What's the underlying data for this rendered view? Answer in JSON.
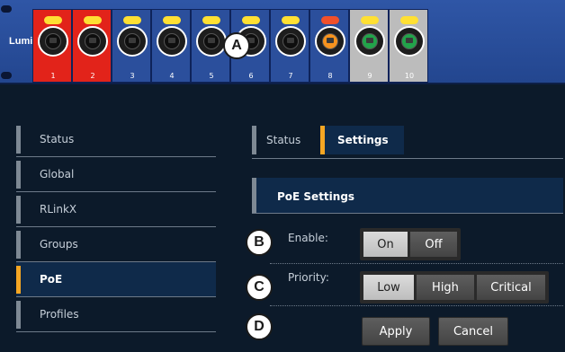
{
  "device": {
    "brand": "Luminex",
    "ports": [
      {
        "number": "1",
        "bg": "#e2231a",
        "led": "#ffe033",
        "jack": "#ffffff",
        "inner": "#0e0e0e"
      },
      {
        "number": "2",
        "bg": "#e2231a",
        "led": "#ffe033",
        "jack": "#ffffff",
        "inner": "#0e0e0e"
      },
      {
        "number": "3",
        "bg": "#2b4f9c",
        "led": "#ffe033",
        "jack": "#ffffff",
        "inner": "#0e0e0e"
      },
      {
        "number": "4",
        "bg": "#2b4f9c",
        "led": "#ffe033",
        "jack": "#ffffff",
        "inner": "#0e0e0e"
      },
      {
        "number": "5",
        "bg": "#2b4f9c",
        "led": "#ffe033",
        "jack": "#ffffff",
        "inner": "#0e0e0e"
      },
      {
        "number": "6",
        "bg": "#2b4f9c",
        "led": "#ffe033",
        "jack": "#ffffff",
        "inner": "#0e0e0e"
      },
      {
        "number": "7",
        "bg": "#2b4f9c",
        "led": "#ffe033",
        "jack": "#ffffff",
        "inner": "#0e0e0e"
      },
      {
        "number": "8",
        "bg": "#2b4f9c",
        "led": "#f0502a",
        "jack": "#ffffff",
        "inner": "#f7931e"
      },
      {
        "number": "9",
        "bg": "#bcbcbc",
        "led": "#ffe033",
        "jack": "#ffffff",
        "inner": "#22a34a"
      },
      {
        "number": "10",
        "bg": "#bcbcbc",
        "led": "#ffe033",
        "jack": "#ffffff",
        "inner": "#22a34a"
      }
    ]
  },
  "sidebar": {
    "items": [
      {
        "label": "Status",
        "active": false
      },
      {
        "label": "Global",
        "active": false
      },
      {
        "label": "RLinkX",
        "active": false
      },
      {
        "label": "Groups",
        "active": false
      },
      {
        "label": "PoE",
        "active": true
      },
      {
        "label": "Profiles",
        "active": false
      }
    ]
  },
  "tabs": {
    "status_label": "Status",
    "settings_label": "Settings",
    "active": "Settings"
  },
  "poe": {
    "title": "PoE Settings",
    "enable_label": "Enable:",
    "enable_options": [
      "On",
      "Off"
    ],
    "enable_selected": "On",
    "priority_label": "Priority:",
    "priority_options": [
      "Low",
      "High",
      "Critical"
    ],
    "priority_selected": "Low",
    "apply_label": "Apply",
    "cancel_label": "Cancel"
  },
  "callouts": {
    "a": "A",
    "b": "B",
    "c": "C",
    "d": "D"
  },
  "colors": {
    "accent": "#f5a623",
    "background": "#0c1a2a",
    "panel": "#0f2a4a"
  }
}
